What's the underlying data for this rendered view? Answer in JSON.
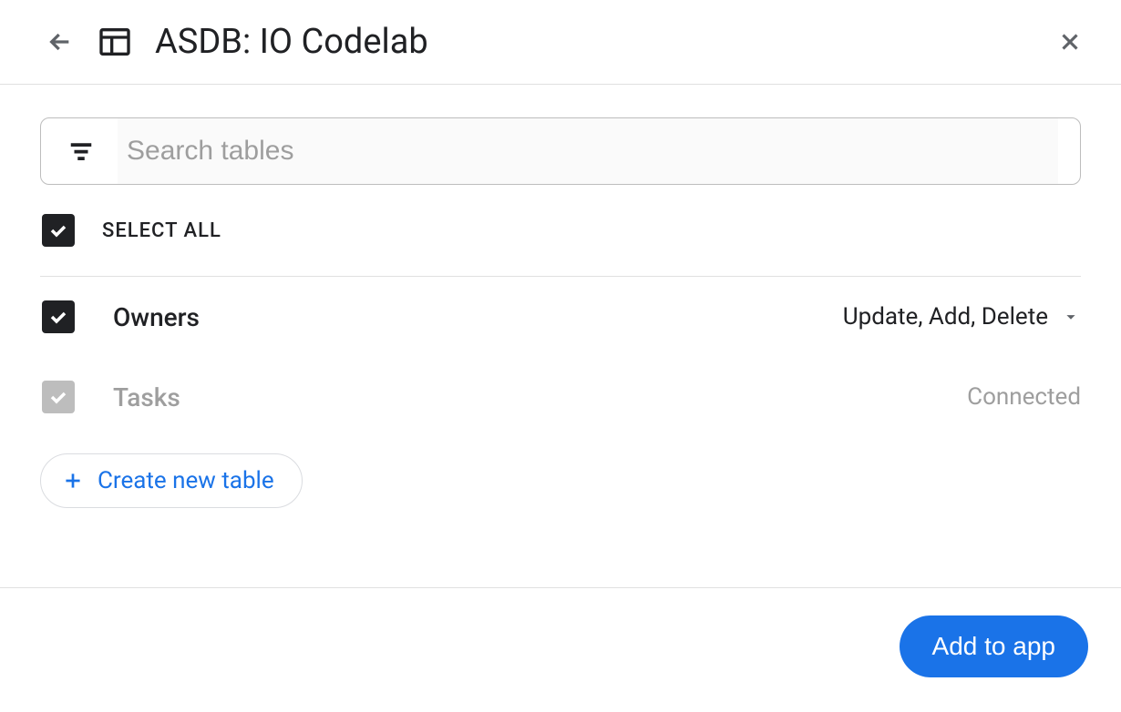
{
  "header": {
    "title": "ASDB: IO Codelab"
  },
  "search": {
    "placeholder": "Search tables",
    "value": ""
  },
  "select_all": {
    "label": "SELECT ALL",
    "checked": true
  },
  "tables": [
    {
      "name": "Owners",
      "checked": true,
      "permissions": "Update, Add, Delete",
      "status": "editable"
    },
    {
      "name": "Tasks",
      "checked": true,
      "permissions": "Connected",
      "status": "connected"
    }
  ],
  "actions": {
    "create_table": "Create new table",
    "add_to_app": "Add to app"
  },
  "colors": {
    "primary": "#1a73e8",
    "text": "#202124",
    "muted": "#9e9e9e",
    "border": "#e0e0e0"
  }
}
